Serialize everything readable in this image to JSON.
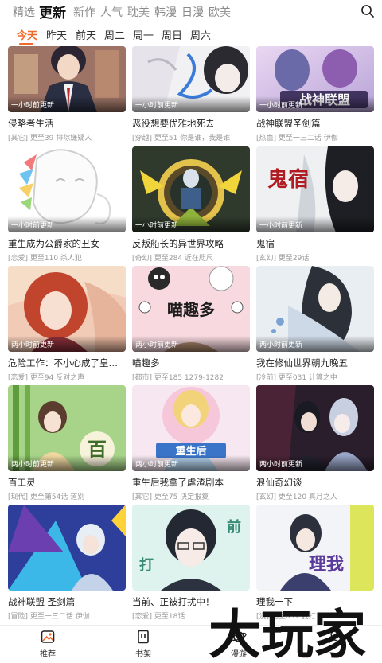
{
  "categories": [
    {
      "label": "精选",
      "active": false
    },
    {
      "label": "更新",
      "active": true
    },
    {
      "label": "新作",
      "active": false
    },
    {
      "label": "人气",
      "active": false
    },
    {
      "label": "耽美",
      "active": false
    },
    {
      "label": "韩漫",
      "active": false
    },
    {
      "label": "日漫",
      "active": false
    },
    {
      "label": "欧美",
      "active": false
    }
  ],
  "days": [
    "今天",
    "昨天",
    "前天",
    "周二",
    "周一",
    "周日",
    "周六"
  ],
  "active_day": "今天",
  "accent_color": "#f26a2a",
  "comics": [
    {
      "title": "侵略者生活",
      "meta": "[其它] 更至39 排除嫌疑人",
      "update": "一小时前更新"
    },
    {
      "title": "恶役想要优雅地死去",
      "meta": "[穿越] 更至51 你是谁，我是谁",
      "update": "一小时前更新"
    },
    {
      "title": "战神联盟圣剑篇",
      "meta": "[热血] 更至一三二话 伊伽",
      "update": "一小时前更新"
    },
    {
      "title": "重生成为公爵家的丑女",
      "meta": "[恋爱] 更至110 杀人犯",
      "update": "一小时前更新"
    },
    {
      "title": "反叛船长的异世界攻略",
      "meta": "[奇幻] 更至284 近在咫尺",
      "update": "一小时前更新"
    },
    {
      "title": "鬼宿",
      "meta": "[玄幻] 更至29话",
      "update": "一小时前更新"
    },
    {
      "title": "危险工作：不小心成了皇帝...",
      "meta": "[恋爱] 更至94 反对之声",
      "update": "两小时前更新"
    },
    {
      "title": "喵趣多",
      "meta": "[都市] 更至185 1279-1282",
      "update": "两小时前更新"
    },
    {
      "title": "我在修仙世界朝九晚五",
      "meta": "[冷前] 更至031 计算之中",
      "update": "两小时前更新"
    },
    {
      "title": "百工灵",
      "meta": "[现代] 更至第54话 道别",
      "update": "两小时前更新"
    },
    {
      "title": "重生后我拿了虐渣剧本",
      "meta": "[其它] 更至75 决定报复",
      "update": "两小时前更新"
    },
    {
      "title": "浪仙奇幻谈",
      "meta": "[玄幻] 更至120 真月之人",
      "update": "两小时前更新"
    },
    {
      "title": "战神联盟 圣剑篇",
      "meta": "[冒险] 更至一三二话 伊伽",
      "update": ""
    },
    {
      "title": "当前、正被打扰中！",
      "meta": "[恋爱] 更至18话",
      "update": ""
    },
    {
      "title": "理我一下",
      "meta": "[漫] 更至057 我打",
      "update": ""
    }
  ],
  "cover_texts": {
    "c3": "战神联盟",
    "c6": "鬼宿",
    "c8": "喵趣多",
    "c10": "百",
    "c11": "重生后",
    "c14": "前",
    "c14b": "打",
    "c15": "理我"
  },
  "bottom_nav": [
    {
      "label": "推荐",
      "icon": "recommend-icon"
    },
    {
      "label": "书架",
      "icon": "bookshelf-icon"
    },
    {
      "label": "漫游",
      "icon": "planet-icon"
    },
    {
      "label": "",
      "icon": "profile-icon"
    }
  ],
  "watermark": "大玩家"
}
